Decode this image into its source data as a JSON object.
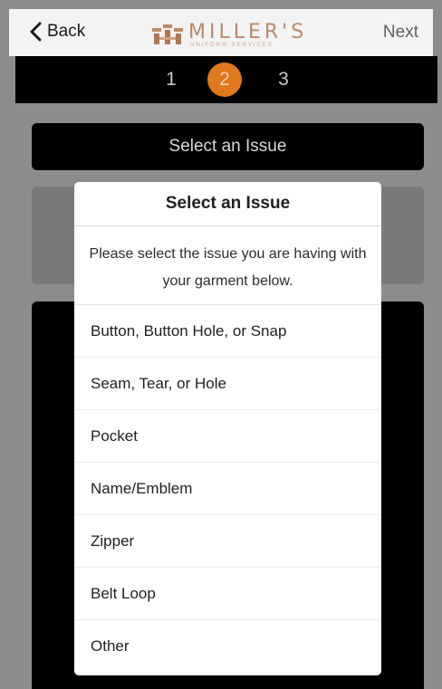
{
  "nav": {
    "back_label": "Back",
    "next_label": "Next",
    "logo_text": "MILLER'S",
    "logo_sub": "UNIFORM SERVICES"
  },
  "steps": [
    "1",
    "2",
    "3"
  ],
  "current_step": "2",
  "colors": {
    "accent": "#e0781d",
    "logo": "#b98a6a"
  },
  "header_button_label": "Select an Issue",
  "modal": {
    "title": "Select an Issue",
    "message": "Please select the issue you are having with your garment below.",
    "options": [
      "Button, Button Hole, or Snap",
      "Seam, Tear, or Hole",
      "Pocket",
      "Name/Emblem",
      "Zipper",
      "Belt Loop",
      "Other"
    ]
  }
}
